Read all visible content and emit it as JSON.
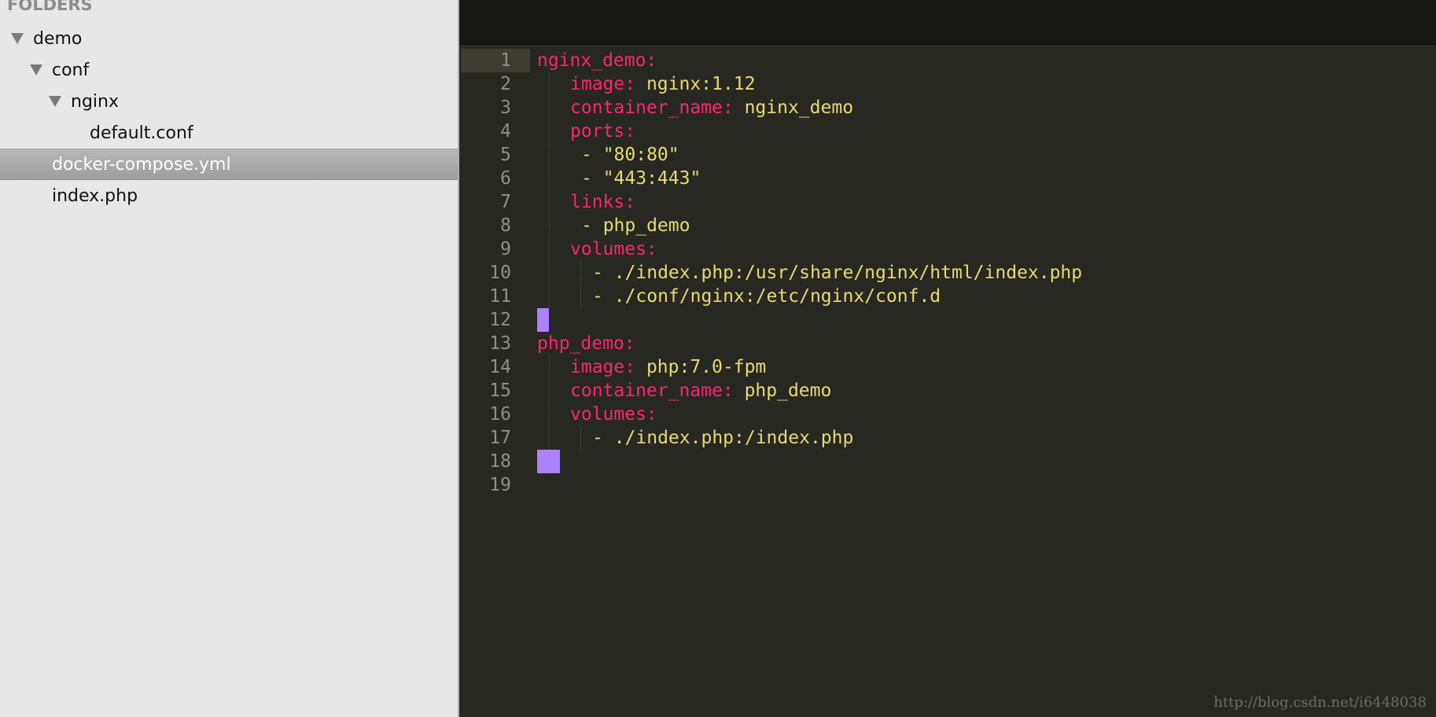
{
  "sidebar": {
    "header": "FOLDERS",
    "items": [
      {
        "label": "demo",
        "expanded": true,
        "level": 0
      },
      {
        "label": "conf",
        "expanded": true,
        "level": 1
      },
      {
        "label": "nginx",
        "expanded": true,
        "level": 2
      },
      {
        "label": "default.conf",
        "level": 3
      },
      {
        "label": "docker-compose.yml",
        "level": 1,
        "selected": true
      },
      {
        "label": "index.php",
        "level": 1
      }
    ]
  },
  "editor": {
    "line_numbers": [
      "1",
      "2",
      "3",
      "4",
      "5",
      "6",
      "7",
      "8",
      "9",
      "10",
      "11",
      "12",
      "13",
      "14",
      "15",
      "16",
      "17",
      "18",
      "19"
    ],
    "lines": [
      {
        "key": "nginx_demo:",
        "value": ""
      },
      {
        "key": "image:",
        "value": " nginx:1.12"
      },
      {
        "key": "container_name:",
        "value": " nginx_demo"
      },
      {
        "key": "ports:",
        "value": ""
      },
      {
        "key": "",
        "value": "- \"80:80\""
      },
      {
        "key": "",
        "value": "- \"443:443\""
      },
      {
        "key": "links:",
        "value": ""
      },
      {
        "key": "",
        "value": "- php_demo"
      },
      {
        "key": "volumes:",
        "value": ""
      },
      {
        "key": "",
        "value": "- ./index.php:/usr/share/nginx/html/index.php"
      },
      {
        "key": "",
        "value": "- ./conf/nginx:/etc/nginx/conf.d"
      },
      {
        "key": "",
        "value": ""
      },
      {
        "key": "php_demo:",
        "value": ""
      },
      {
        "key": "image:",
        "value": " php:7.0-fpm"
      },
      {
        "key": "container_name:",
        "value": " php_demo"
      },
      {
        "key": "volumes:",
        "value": ""
      },
      {
        "key": "",
        "value": "- ./index.php:/index.php"
      },
      {
        "key": "",
        "value": ""
      },
      {
        "key": "",
        "value": ""
      }
    ]
  },
  "colors": {
    "key": "#f92672",
    "value": "#e6db74",
    "cursor": "#ae81ff",
    "background": "#272822"
  },
  "watermark": "http://blog.csdn.net/i6448038"
}
